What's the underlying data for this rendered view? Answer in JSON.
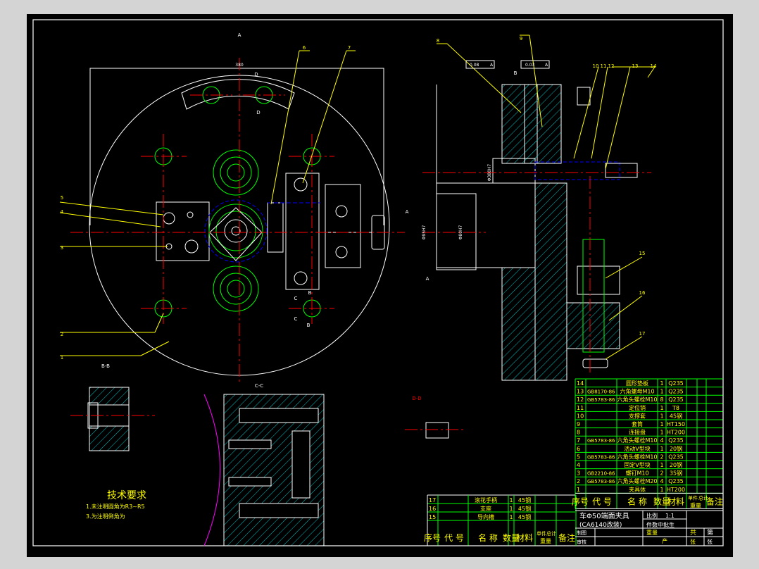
{
  "drawing": {
    "colors": {
      "background": "#000000",
      "frame": "#ffffff",
      "outline": "#ffffff",
      "hatch": "#00c0c0",
      "centerline": "#ff0000",
      "table_grid": "#00ff00",
      "text": "#ffff00",
      "leader": "#ffff00",
      "hidden": "#0000ff",
      "magenta": "#ff00ff"
    },
    "view_labels": {
      "a": "A",
      "d_top": "D",
      "d_bot": "D",
      "b1": "B",
      "b2": "B",
      "c1": "C",
      "c2": "C",
      "a_right": "A",
      "bb": "B-B",
      "cc": "C-C",
      "dd": "D-D"
    },
    "dimension_top": "380",
    "balloons": [
      "1",
      "2",
      "3",
      "4",
      "5",
      "6",
      "7",
      "8",
      "9",
      "10",
      "11",
      "12",
      "13",
      "14",
      "15",
      "16",
      "17"
    ],
    "tolerances": {
      "t1": "0.08",
      "t1b": "A",
      "t2": "0.03",
      "t2b": "A",
      "datum_b": "B",
      "datum_a": "A"
    },
    "dims_right": {
      "d1": "Φ380H7",
      "d2": "Φ95H7",
      "d3": "Φ80H7"
    }
  },
  "tech_requirements": {
    "title": "技术要求",
    "items": [
      "1.未注明圆角为R3~R5",
      "3.为注明倒角为"
    ]
  },
  "bom": {
    "rows": [
      {
        "no": "14",
        "code": "",
        "name": "圆形垫板",
        "qty": "1",
        "material": "Q235"
      },
      {
        "no": "13",
        "code": "GB8170-86",
        "name": "六角螺母M10",
        "qty": "1",
        "material": "Q235"
      },
      {
        "no": "12",
        "code": "GB5783-86",
        "name": "六角头螺栓M10",
        "qty": "8",
        "material": "Q235"
      },
      {
        "no": "11",
        "code": "",
        "name": "定位销",
        "qty": "1",
        "material": "T8"
      },
      {
        "no": "10",
        "code": "",
        "name": "支撑套",
        "qty": "1",
        "material": "45钢"
      },
      {
        "no": "9",
        "code": "",
        "name": "套筒",
        "qty": "1",
        "material": "HT150"
      },
      {
        "no": "8",
        "code": "",
        "name": "连接盘",
        "qty": "1",
        "material": "HT200"
      },
      {
        "no": "7",
        "code": "GB5783-86",
        "name": "六角头螺栓M10",
        "qty": "4",
        "material": "Q235"
      },
      {
        "no": "6",
        "code": "",
        "name": "活动V型块",
        "qty": "1",
        "material": "20钢"
      },
      {
        "no": "5",
        "code": "GB5783-86",
        "name": "六角头螺栓M10",
        "qty": "2",
        "material": "Q235"
      },
      {
        "no": "4",
        "code": "",
        "name": "固定V型块",
        "qty": "1",
        "material": "20钢"
      },
      {
        "no": "3",
        "code": "GB2210-86",
        "name": "螺钉M10",
        "qty": "2",
        "material": "35钢"
      },
      {
        "no": "2",
        "code": "GB5783-86",
        "name": "六角头螺栓M20",
        "qty": "4",
        "material": "Q235"
      },
      {
        "no": "1",
        "code": "",
        "name": "夹具体",
        "qty": "1",
        "material": "HT200"
      }
    ],
    "header": {
      "no": "序号",
      "code": "代 号",
      "name": "名 称",
      "qty": "数量",
      "material": "材料",
      "unit_weight": "单件",
      "total_weight": "总计",
      "weight": "重量",
      "remark": "备注"
    }
  },
  "bom_lower": {
    "rows": [
      {
        "no": "17",
        "name": "滚花手柄",
        "qty": "1",
        "material": "45钢"
      },
      {
        "no": "16",
        "name": "支座",
        "qty": "1",
        "material": "45钢"
      },
      {
        "no": "15",
        "name": "导向槽",
        "qty": "1",
        "material": "45钢"
      }
    ]
  },
  "title_block": {
    "title_line1": "车Φ50端面夹具",
    "title_line2": "(CA6140改装)",
    "scale_label": "比例",
    "scale": "1:1",
    "sheet_info": "件数中批生",
    "weight_label": "重量",
    "drawn_by": "制图",
    "checked_by": "审核",
    "total_sheets_label": "共",
    "sheet_label": "第",
    "zhang1": "张",
    "zhang2": "张",
    "chan": "产"
  }
}
